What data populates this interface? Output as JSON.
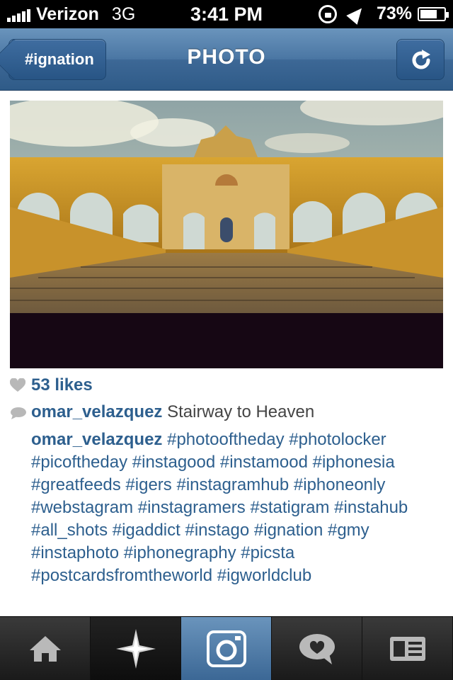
{
  "status_bar": {
    "carrier": "Verizon",
    "network": "3G",
    "time": "3:41 PM",
    "battery": "73%",
    "icons": [
      "signal-icon",
      "rotation-lock-icon",
      "location-icon",
      "battery-icon"
    ]
  },
  "navbar": {
    "back_label": "#ignation",
    "title": "PHOTO",
    "refresh_icon": "refresh-icon"
  },
  "post": {
    "likes": "53 likes",
    "caption": {
      "username": "omar_velazquez",
      "text": "Stairway to Heaven"
    },
    "comment": {
      "username": "omar_velazquez",
      "text": "#photooftheday #photolocker #picoftheday #instagood #instamood #iphonesia #greatfeeds #igers #instagramhub #iphoneonly #webstagram #instagramers #statigram #instahub #all_shots #igaddict #instago #ignation #gmy #instaphoto #iphonegraphy #picsta #postcardsfromtheworld #igworldclub"
    }
  },
  "tabbar": {
    "tabs": [
      {
        "icon": "home-icon"
      },
      {
        "icon": "explore-star-icon"
      },
      {
        "icon": "camera-icon",
        "active": true
      },
      {
        "icon": "activity-heart-bubble-icon"
      },
      {
        "icon": "profile-card-icon"
      }
    ]
  },
  "colors": {
    "accent": "#2d5f8e",
    "navbar": "#4a76a3",
    "tab_active": "#4a76a3"
  }
}
